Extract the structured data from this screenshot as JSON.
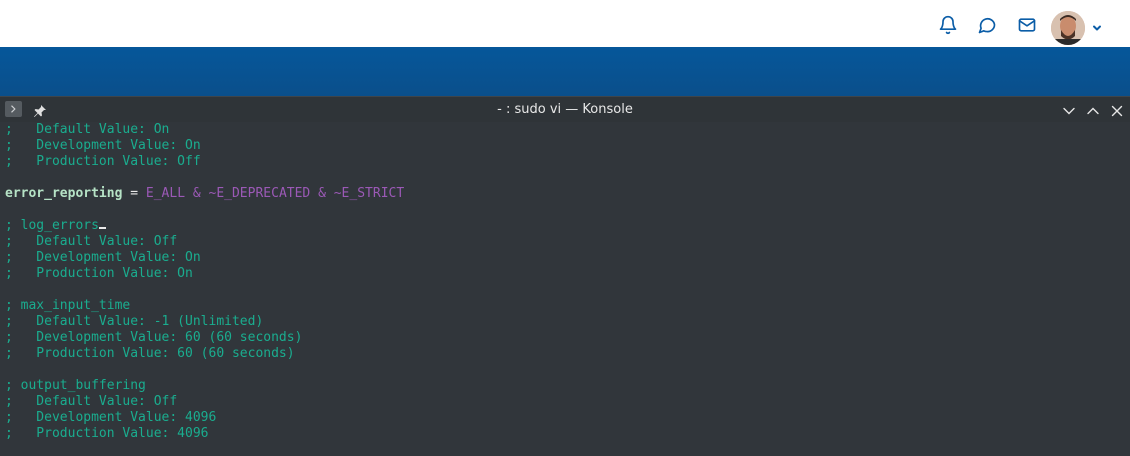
{
  "header": {
    "icons": [
      "bell-icon",
      "chat-icon",
      "mail-icon"
    ],
    "avatar_alt": "user-avatar"
  },
  "window": {
    "title": "- : sudo vi — Konsole",
    "buttons": [
      "minimize-icon",
      "maximize-icon",
      "close-icon"
    ]
  },
  "terminal": {
    "lines": [
      {
        "kind": "comment",
        "text": ";   Default Value: On"
      },
      {
        "kind": "comment",
        "text": ";   Development Value: On"
      },
      {
        "kind": "comment",
        "text": ";   Production Value: Off"
      },
      {
        "kind": "blank",
        "text": ""
      },
      {
        "kind": "setting",
        "key": "error_reporting",
        "eq": " = ",
        "value": "E_ALL & ~E_DEPRECATED & ~E_STRICT"
      },
      {
        "kind": "blank",
        "text": ""
      },
      {
        "kind": "comment-cursor",
        "text": "; log_errors"
      },
      {
        "kind": "comment",
        "text": ";   Default Value: Off"
      },
      {
        "kind": "comment",
        "text": ";   Development Value: On"
      },
      {
        "kind": "comment",
        "text": ";   Production Value: On"
      },
      {
        "kind": "blank",
        "text": ""
      },
      {
        "kind": "comment",
        "text": "; max_input_time"
      },
      {
        "kind": "comment",
        "text": ";   Default Value: -1 (Unlimited)"
      },
      {
        "kind": "comment",
        "text": ";   Development Value: 60 (60 seconds)"
      },
      {
        "kind": "comment",
        "text": ";   Production Value: 60 (60 seconds)"
      },
      {
        "kind": "blank",
        "text": ""
      },
      {
        "kind": "comment",
        "text": "; output_buffering"
      },
      {
        "kind": "comment",
        "text": ";   Default Value: Off"
      },
      {
        "kind": "comment",
        "text": ";   Development Value: 4096"
      },
      {
        "kind": "comment",
        "text": ";   Production Value: 4096"
      }
    ]
  },
  "colors": {
    "blue_band": "#06579a",
    "terminal_bg": "#31363b",
    "comment": "#1aad8f",
    "key": "#b6e3c6",
    "constant": "#9b59b6"
  }
}
